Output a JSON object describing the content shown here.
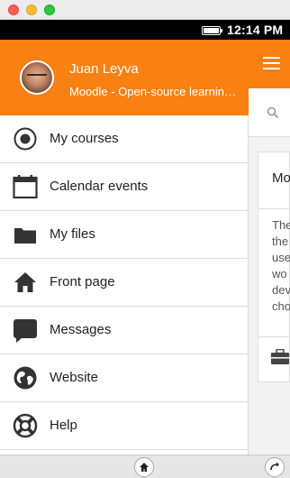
{
  "status_bar": {
    "time": "12:14 PM"
  },
  "user": {
    "name": "Juan Leyva",
    "site": "Moodle - Open-source learning platform"
  },
  "menu_items": [
    {
      "label": "My courses",
      "icon": "courses-icon"
    },
    {
      "label": "Calendar events",
      "icon": "calendar-icon"
    },
    {
      "label": "My files",
      "icon": "folder-icon"
    },
    {
      "label": "Front page",
      "icon": "home-icon"
    },
    {
      "label": "Messages",
      "icon": "chat-bubble-icon"
    },
    {
      "label": "Website",
      "icon": "globe-icon"
    },
    {
      "label": "Help",
      "icon": "lifebuoy-icon"
    }
  ],
  "background_card": {
    "title": "Mo",
    "text": "The\nthe\nuse\nwo\ndev\ncho"
  },
  "colors": {
    "accent": "#f98012",
    "status_bar": "#000000"
  }
}
